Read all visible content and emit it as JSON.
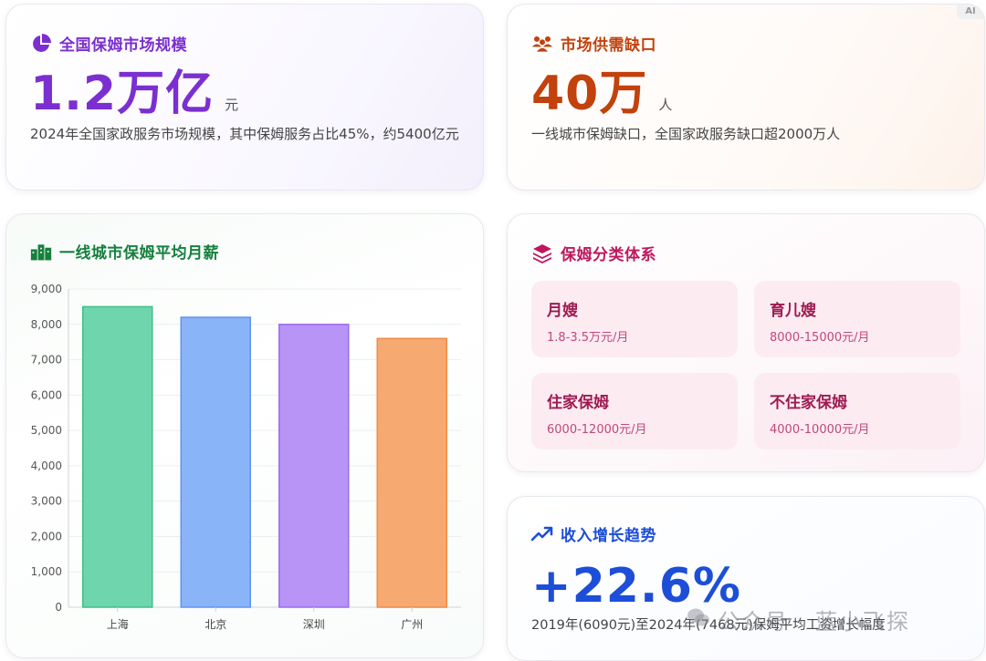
{
  "market_size": {
    "title": "全国保姆市场规模",
    "value": "1.2万亿",
    "unit": "元",
    "description": "2024年全国家政服务市场规模，其中保姆服务占比45%，约5400亿元",
    "accent": "#7b2fd1",
    "icon": "pie-chart-icon"
  },
  "supply_gap": {
    "title": "市场供需缺口",
    "value": "40万",
    "unit": "人",
    "description": "一线城市保姆缺口，全国家政服务缺口超2000万人",
    "accent": "#c2410c",
    "icon": "people-group-icon"
  },
  "salary": {
    "title": "一线城市保姆平均月薪",
    "accent": "#15803d",
    "icon": "city-buildings-icon"
  },
  "types": {
    "title": "保姆分类体系",
    "accent": "#be185d",
    "icon": "layers-icon",
    "items": [
      {
        "name": "月嫂",
        "price": "1.8-3.5万元/月"
      },
      {
        "name": "育儿嫂",
        "price": "8000-15000元/月"
      },
      {
        "name": "住家保姆",
        "price": "6000-12000元/月"
      },
      {
        "name": "不住家保姆",
        "price": "4000-10000元/月"
      }
    ]
  },
  "growth": {
    "title": "收入增长趋势",
    "value": "+22.6%",
    "description": "2019年(6090元)至2024年(7468元)保姆平均工资增长幅度",
    "accent": "#1d4ed8",
    "icon": "trend-up-icon"
  },
  "watermark": "公众号 · 蓝小飞探",
  "ai_badge": "AI",
  "chart_data": {
    "type": "bar",
    "categories": [
      "上海",
      "北京",
      "深圳",
      "广州"
    ],
    "values": [
      8500,
      8200,
      8000,
      7600
    ],
    "ylim": [
      0,
      9000
    ],
    "yticks": [
      "0",
      "1,000",
      "2,000",
      "3,000",
      "4,000",
      "5,000",
      "6,000",
      "7,000",
      "8,000",
      "9,000"
    ],
    "colors": [
      "#6fd5ad",
      "#8ab4f8",
      "#b794f6",
      "#f6aa72"
    ],
    "edge_colors": [
      "#3fbf8a",
      "#5f94f0",
      "#9a6cf0",
      "#ef8a45"
    ],
    "grid": true,
    "legend": "none"
  }
}
